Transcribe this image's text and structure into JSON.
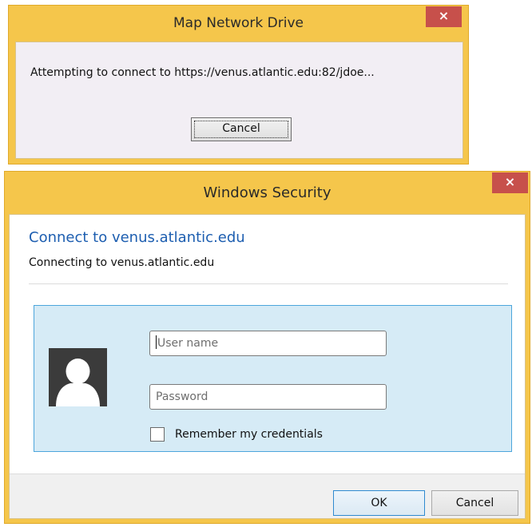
{
  "map_drive_dialog": {
    "title": "Map Network Drive",
    "close_glyph": "×",
    "message": "Attempting to connect to https://venus.atlantic.edu:82/jdoe...",
    "cancel_label": "Cancel"
  },
  "security_dialog": {
    "title": "Windows Security",
    "close_glyph": "×",
    "heading": "Connect to venus.atlantic.edu",
    "subheading": "Connecting to venus.atlantic.edu",
    "username_placeholder": "User name",
    "password_placeholder": "Password",
    "remember_label": "Remember my credentials",
    "remember_checked": false,
    "ok_label": "OK",
    "cancel_label": "Cancel",
    "avatar_icon": "user-avatar-icon"
  },
  "colors": {
    "title_bar": "#f5c64b",
    "close_button": "#c7504b",
    "heading_blue": "#1d5eb0",
    "tile_background": "#d6ebf6",
    "tile_border": "#4da6dc"
  }
}
